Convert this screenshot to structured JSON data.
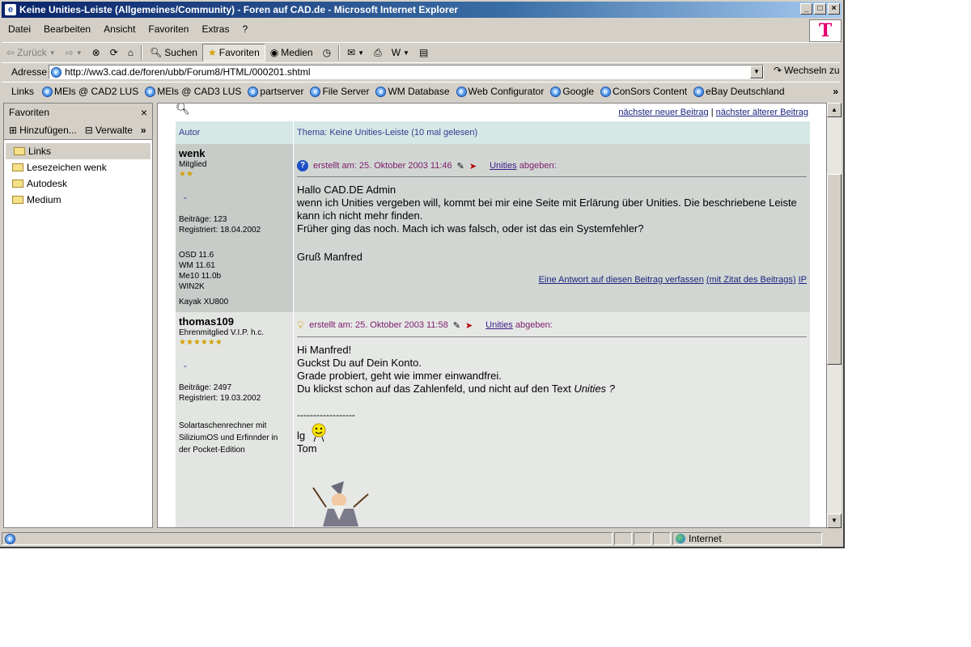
{
  "window": {
    "title": "Keine Unities-Leiste (Allgemeines/Community) - Foren auf CAD.de - Microsoft Internet Explorer",
    "brand_logo": "T"
  },
  "menu": [
    "Datei",
    "Bearbeiten",
    "Ansicht",
    "Favoriten",
    "Extras",
    "?"
  ],
  "toolbar": {
    "back": "Zurück",
    "search": "Suchen",
    "favorites": "Favoriten",
    "media": "Medien"
  },
  "address": {
    "label": "Adresse",
    "url": "http://ww3.cad.de/foren/ubb/Forum8/HTML/000201.shtml",
    "go": "Wechseln zu"
  },
  "links": {
    "label": "Links",
    "items": [
      "MEls @ CAD2 LUS",
      "MEls @ CAD3 LUS",
      "partserver",
      "File Server",
      "WM Database",
      "Web Configurator",
      "Google",
      "ConSors Content",
      "eBay Deutschland"
    ]
  },
  "favorites": {
    "title": "Favoriten",
    "add": "Hinzufügen...",
    "manage": "Verwalte",
    "folders": [
      "Links",
      "Lesezeichen wenk",
      "Autodesk",
      "Medium"
    ]
  },
  "thread": {
    "nav_newer": "nächster neuer Beitrag",
    "nav_sep": "|",
    "nav_older": "nächster älterer Beitrag",
    "col_author": "Autor",
    "col_topic": "Thema:  Keine Unities-Leiste (10 mal gelesen)"
  },
  "posts": [
    {
      "author": "wenk",
      "rank": "Mitglied",
      "stars": "★★",
      "dash": "-",
      "posts_count": "Beiträge: 123",
      "registered": "Registriert: 18.04.2002",
      "signature": [
        "OSD 11.6",
        "WM 11.61",
        "Me10 11.0b",
        "WIN2K",
        "",
        "Kayak XU800"
      ],
      "created": "erstellt am: 25. Oktober 2003 11:46",
      "unities_link": "Unities",
      "unities_tail": "abgeben:",
      "lines": [
        "Hallo CAD.DE Admin",
        "wenn ich Unities vergeben will, kommt bei mir eine Seite mit Erlärung über Unities. Die beschriebene Leiste kann ich nicht mehr finden.",
        "Früher ging das noch. Mach ich was falsch, oder ist das ein Systemfehler?",
        "",
        "Gruß  Manfred"
      ],
      "reply_link": "Eine Antwort auf diesen Beitrag verfassen",
      "quote_link": "(mit Zitat des Beitrags)",
      "ip_link": "IP"
    },
    {
      "author": "thomas109",
      "rank": "Ehrenmitglied V.I.P. h.c.",
      "stars": "★★★★★★",
      "dash": "-",
      "posts_count": "Beiträge: 2497",
      "registered": "Registriert: 19.03.2002",
      "signature": [
        "Solartaschenrechner mit",
        "SiliziumOS und Erfinnder in",
        "der Pocket-Edition"
      ],
      "created": "erstellt am: 25. Oktober 2003 11:58",
      "unities_link": "Unities",
      "unities_tail": "abgeben:",
      "lines": [
        "Hi Manfred!",
        "Guckst Du auf Dein Konto.",
        "Grade probiert, geht wie immer einwandfrei."
      ],
      "line_last_prefix": "Du klickst schon auf das Zahlenfeld, und nicht auf den Text",
      "line_last_em": "Unities ?",
      "sig_rule": "------------------",
      "sig_lg": "lg",
      "sig_name": "Tom"
    }
  ],
  "status": {
    "zone": "Internet"
  }
}
